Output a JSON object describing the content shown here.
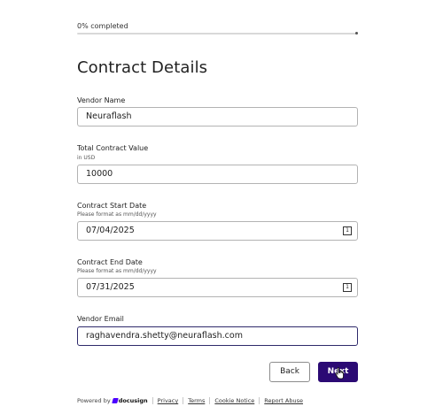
{
  "progress": {
    "label": "0% completed",
    "percent": 0
  },
  "form": {
    "title": "Contract Details",
    "vendor_name": {
      "label": "Vendor Name",
      "value": "Neuraflash"
    },
    "total_contract_value": {
      "label": "Total Contract Value",
      "help": "in USD",
      "value": "10000"
    },
    "start_date": {
      "label": "Contract Start Date",
      "help": "Please format as mm/dd/yyyy",
      "value": "07/04/2025",
      "icon": "calendar-icon",
      "icon_glyph": "1"
    },
    "end_date": {
      "label": "Contract End Date",
      "help": "Please format as mm/dd/yyyy",
      "value": "07/31/2025",
      "icon": "calendar-icon",
      "icon_glyph": "1"
    },
    "vendor_email": {
      "label": "Vendor Email",
      "value": "raghavendra.shetty@neuraflash.com"
    }
  },
  "buttons": {
    "back": "Back",
    "next": "Next"
  },
  "footer": {
    "powered_by": "Powered by",
    "brand": "docusign",
    "links": [
      "Privacy",
      "Terms",
      "Cookie Notice",
      "Report Abuse"
    ]
  },
  "colors": {
    "primary": "#2b0a74",
    "brand_mark": "#4c00ff",
    "input_border": "#b3b3b3",
    "focused_border": "#2e2a6b"
  }
}
